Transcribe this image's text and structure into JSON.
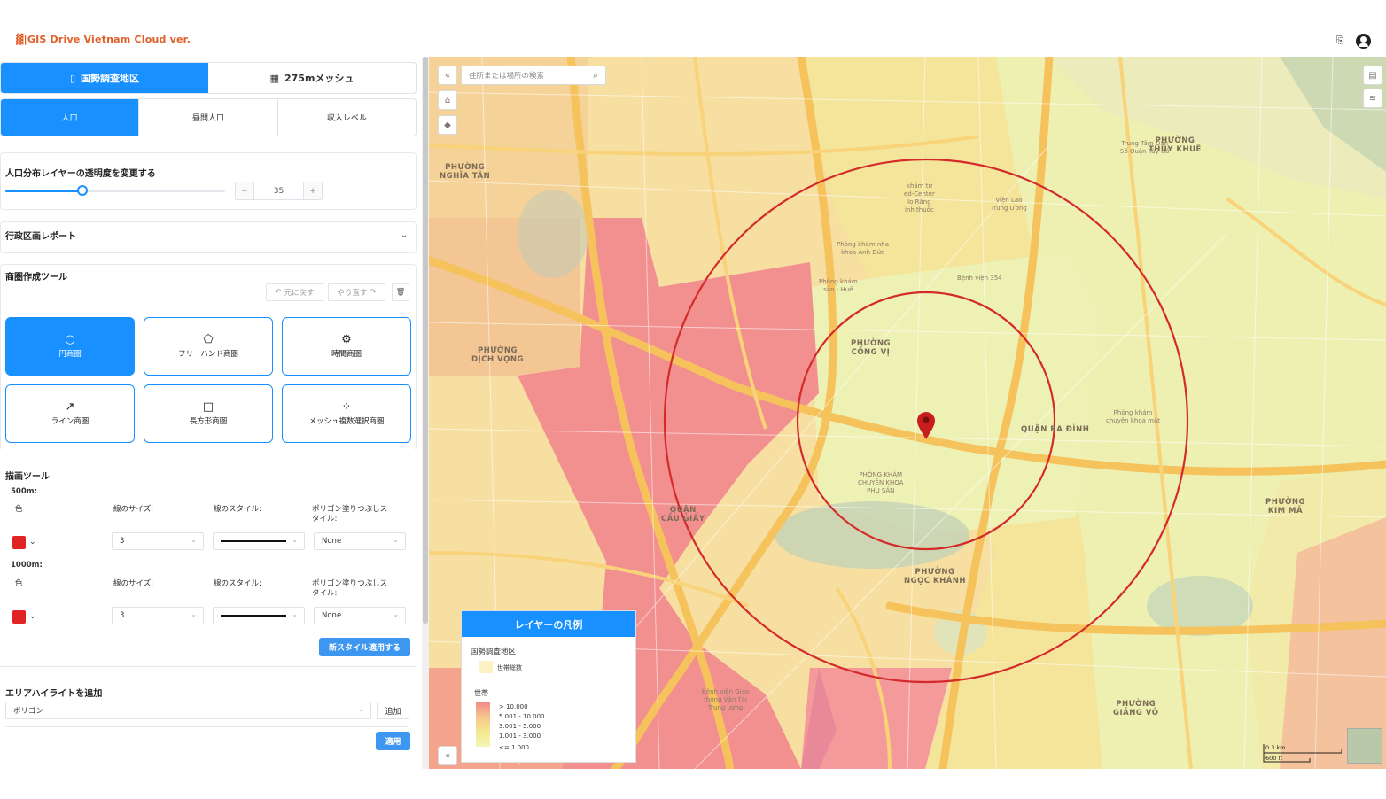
{
  "header": {
    "logo": "▓|GIS Drive Vietnam Cloud ver.",
    "lang_icon": "translate-icon",
    "user_icon": "user-icon"
  },
  "sidebar": {
    "top_tabs": [
      {
        "label": "国勢調査地区",
        "icon": "document-icon",
        "active": true
      },
      {
        "label": "275mメッシュ",
        "icon": "grid-icon",
        "active": false
      }
    ],
    "sub_tabs": [
      {
        "label": "人口",
        "active": true
      },
      {
        "label": "昼間人口",
        "active": false
      },
      {
        "label": "収入レベル",
        "active": false
      }
    ],
    "opacity": {
      "title": "人口分布レイヤーの透明度を変更する",
      "value": "35",
      "level": 0.35,
      "minus": "−",
      "plus": "+"
    },
    "admin_report": {
      "title": "行政区画レポート"
    },
    "trade_area": {
      "title": "商圏作成ツール",
      "undo": "元に戻す",
      "redo": "やり直す",
      "tools": [
        {
          "label": "円商圏",
          "icon": "circle-icon",
          "glyph": "○",
          "active": true
        },
        {
          "label": "フリーハンド商圏",
          "icon": "freehand-icon",
          "glyph": "⬠",
          "active": false
        },
        {
          "label": "時間商圏",
          "icon": "time-area-icon",
          "glyph": "⚙",
          "active": false
        },
        {
          "label": "ライン商圏",
          "icon": "line-icon",
          "glyph": "↗",
          "active": false
        },
        {
          "label": "長方形商圏",
          "icon": "rectangle-icon",
          "glyph": "□",
          "active": false
        },
        {
          "label": "メッシュ複数選択商圏",
          "icon": "mesh-select-icon",
          "glyph": "⁘",
          "active": false
        }
      ]
    },
    "drawing": {
      "title": "描画ツール",
      "rings": [
        {
          "name": "500m:",
          "color_label": "色",
          "size_label": "線のサイズ:",
          "style_label": "線のスタイル:",
          "fill_label": "ポリゴン塗りつぶしス\nタイル:",
          "color": "#e02424",
          "size": "3",
          "fill": "None"
        },
        {
          "name": "1000m:",
          "color_label": "色",
          "size_label": "線のサイズ:",
          "style_label": "線のスタイル:",
          "fill_label": "ポリゴン塗りつぶしス\nタイル:",
          "color": "#e02424",
          "size": "3",
          "fill": "None"
        }
      ],
      "apply_style": "新スタイル適用する"
    },
    "highlight": {
      "title": "エリアハイライトを追加",
      "select": "ポリゴン",
      "add": "追加",
      "apply": "適用"
    }
  },
  "map": {
    "search_placeholder": "住所または場所の検索",
    "districts": [
      "PHƯỜNG\nNGHĨA TÂN",
      "PHƯỜNG\nDỊCH VỌNG",
      "QUẬN\nCẦU GIẤY",
      "PHƯỜNG\nCỐNG VỊ",
      "QUẬN BA ĐÌNH",
      "PHƯỜNG\nNGỌC KHÁNH",
      "PHƯỜNG\nTHỤY KHUÊ",
      "PHƯỜNG\nKIM MÃ",
      "PHƯỜNG\nGIẢNG VÕ"
    ],
    "places": [
      "khám tư\ned-Center\nlo Răng\ninh thuốc",
      "Viện Lao\nTrung Ương",
      "Phòng khám nha\nkhoa Anh Đức",
      "Bệnh viện 354",
      "PHÒNG KHÁM\nCHUYÊN KHOA\nPHỤ SẢN",
      "Phòng khám\nchuyên khoa mắt",
      "Bệnh viện Giao\nthông Vận Tải\nTrung ương",
      "Trung Tâm Dân\nSố Quận Tây Hồ",
      "Phòng khám\nsản - Huế"
    ],
    "legend": {
      "title": "レイヤーの凡例",
      "layer": "国勢調査地区",
      "swatch_label": "世帯総数",
      "ramp_title": "世帯",
      "ramp": [
        "> 10.000",
        "5.001 - 10.000",
        "3.001 - 5.000",
        "1.001 - 3.000",
        "<= 1.000"
      ]
    },
    "scale": {
      "km": "0.3 km",
      "ft": "600 ft"
    },
    "colors": {
      "ring": "#d42a2a",
      "high": "#f08c8c",
      "mid": "#f6c88c",
      "low": "#eef0b0"
    }
  }
}
